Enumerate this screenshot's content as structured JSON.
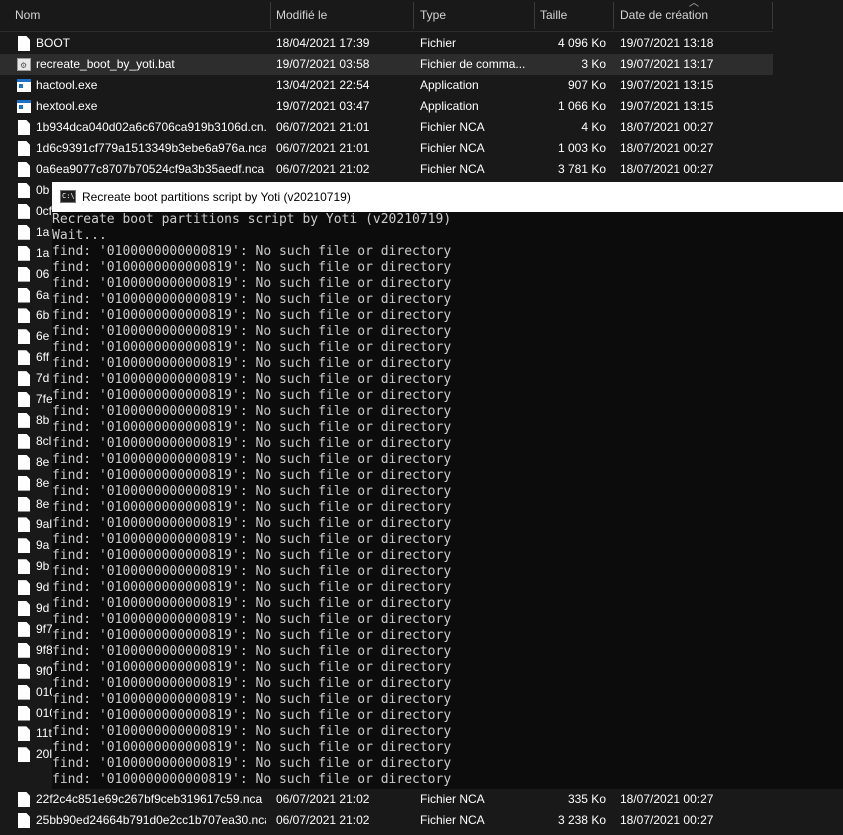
{
  "explorer": {
    "columns": {
      "name": "Nom",
      "modified": "Modifié le",
      "type": "Type",
      "size": "Taille",
      "created": "Date de création"
    },
    "files": [
      {
        "name": "BOOT",
        "modified": "18/04/2021 17:39",
        "type": "Fichier",
        "size": "4 096 Ko",
        "created": "19/07/2021 13:18",
        "icon": "file-icon"
      },
      {
        "name": "recreate_boot_by_yoti.bat",
        "modified": "19/07/2021 03:58",
        "type": "Fichier de comma...",
        "size": "3 Ko",
        "created": "19/07/2021 13:17",
        "icon": "batch-file-icon",
        "selected": true
      },
      {
        "name": "hactool.exe",
        "modified": "13/04/2021 22:54",
        "type": "Application",
        "size": "907 Ko",
        "created": "19/07/2021 13:15",
        "icon": "exe-icon"
      },
      {
        "name": "hextool.exe",
        "modified": "19/07/2021 03:47",
        "type": "Application",
        "size": "1 066 Ko",
        "created": "19/07/2021 13:15",
        "icon": "exe-icon"
      },
      {
        "name": "1b934dca040d02a6c6706ca919b3106d.cn...",
        "modified": "06/07/2021 21:01",
        "type": "Fichier NCA",
        "size": "4 Ko",
        "created": "18/07/2021 00:27",
        "icon": "file-icon"
      },
      {
        "name": "1d6c9391cf779a1513349b3ebe6a976a.nca",
        "modified": "06/07/2021 21:01",
        "type": "Fichier NCA",
        "size": "1 003 Ko",
        "created": "18/07/2021 00:27",
        "icon": "file-icon"
      },
      {
        "name": "0a6ea9077c8707b70524cf9a3b35aedf.nca",
        "modified": "06/07/2021 21:02",
        "type": "Fichier NCA",
        "size": "3 781 Ko",
        "created": "18/07/2021 00:27",
        "icon": "file-icon"
      }
    ],
    "hidden_rows": [
      "0b",
      "0cf",
      "1a",
      "1a",
      "06",
      "6a",
      "6b",
      "6e",
      "6ff",
      "7d",
      "7fe",
      "8b",
      "8cl",
      "8e",
      "8e",
      "8e",
      "9al",
      "9a",
      "9b",
      "9d",
      "9d",
      "9f7",
      "9f8",
      "9f0",
      "010",
      "010",
      "11t",
      "20l"
    ],
    "bottom_files": [
      {
        "name": "22f2c4c851e69c267bf9ceb319617c59.nca",
        "modified": "06/07/2021 21:02",
        "type": "Fichier NCA",
        "size": "335 Ko",
        "created": "18/07/2021 00:27",
        "icon": "file-icon"
      },
      {
        "name": "25bb90ed24664b791d0e2cc1b707ea30.nca",
        "modified": "06/07/2021 21:02",
        "type": "Fichier NCA",
        "size": "3 238 Ko",
        "created": "18/07/2021 00:27",
        "icon": "file-icon"
      }
    ]
  },
  "console": {
    "title": "Recreate boot partitions script by Yoti (v20210719)",
    "icon": "cmd-icon",
    "header_line": "Recreate boot partitions script by Yoti (v20210719)",
    "wait_line": "Wait...",
    "error_line": "find: '0100000000000819': No such file or directory",
    "error_count": 34
  }
}
